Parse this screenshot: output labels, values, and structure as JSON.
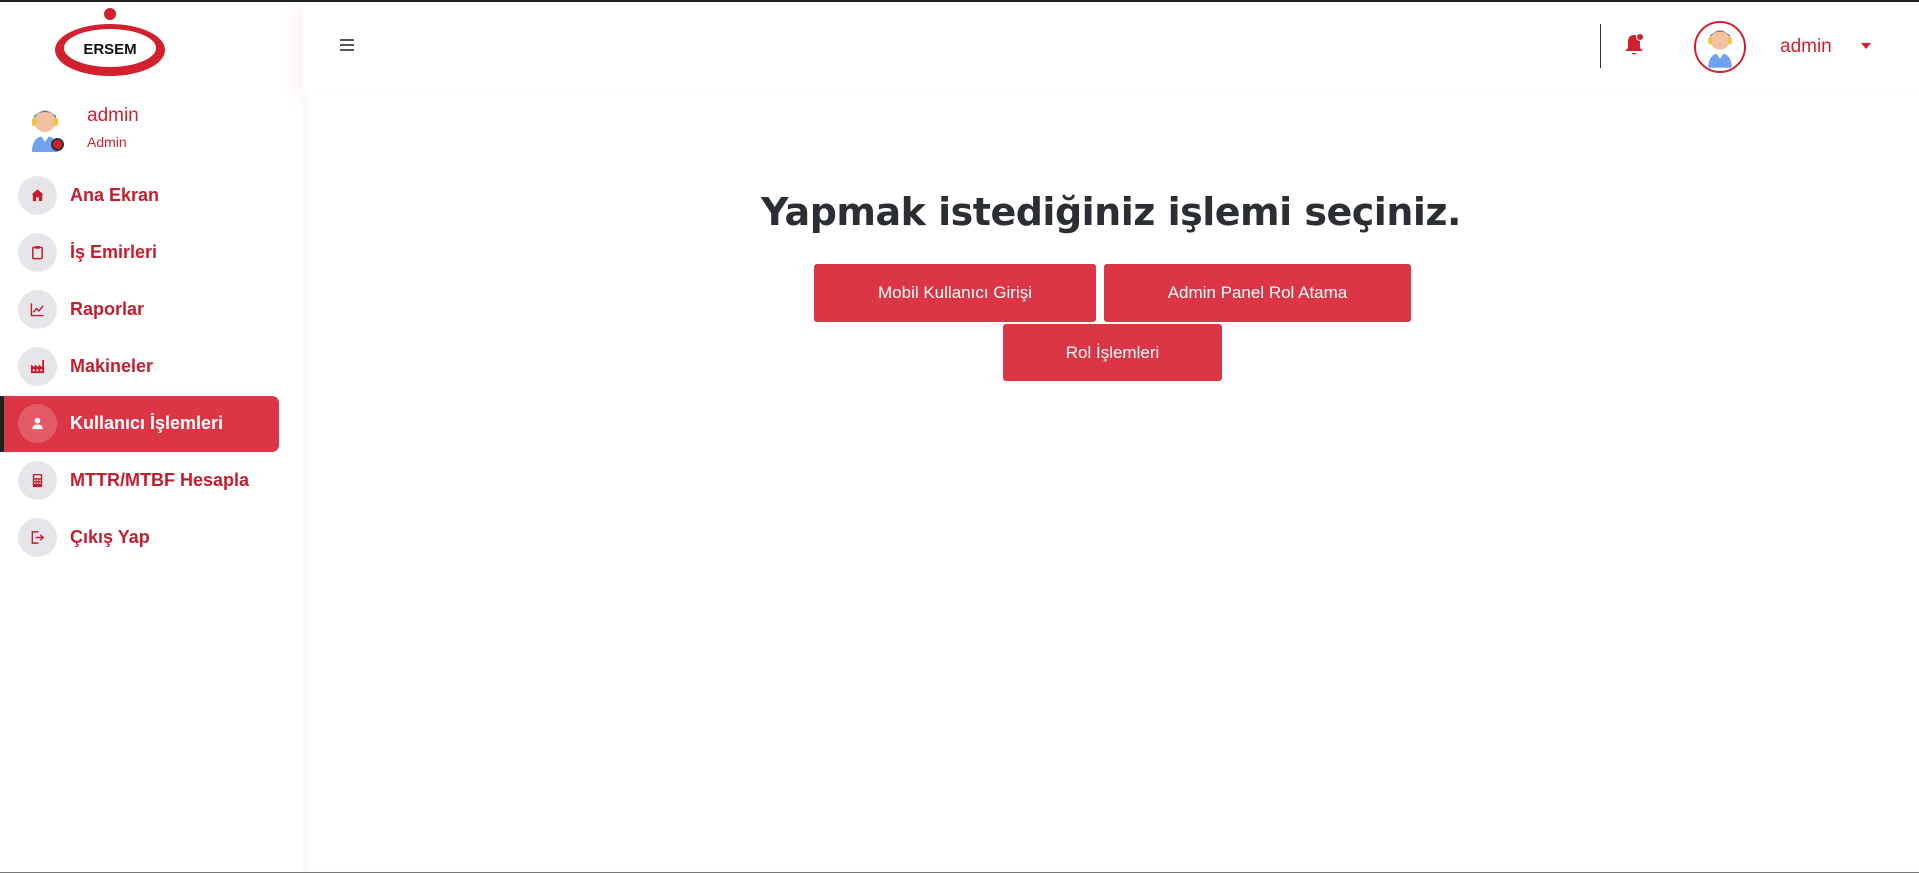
{
  "logo": {
    "text": "ERSEM"
  },
  "sidebar": {
    "user": {
      "name": "admin",
      "role": "Admin"
    },
    "items": [
      {
        "label": "Ana Ekran",
        "icon": "home-icon"
      },
      {
        "label": "İş Emirleri",
        "icon": "clipboard-icon"
      },
      {
        "label": "Raporlar",
        "icon": "chart-line-icon"
      },
      {
        "label": "Makineler",
        "icon": "factory-icon"
      },
      {
        "label": "Kullanıcı İşlemleri",
        "icon": "user-icon",
        "active": true
      },
      {
        "label": "MTTR/MTBF Hesapla",
        "icon": "calculator-icon"
      },
      {
        "label": "Çıkış Yap",
        "icon": "logout-icon"
      }
    ]
  },
  "header": {
    "username": "admin"
  },
  "main": {
    "title": "Yapmak istediğiniz işlemi seçiniz.",
    "buttons": {
      "mobile_login": "Mobil Kullanıcı Girişi",
      "admin_role": "Admin Panel Rol Atama",
      "role_ops": "Rol İşlemleri"
    }
  },
  "colors": {
    "accent": "#dc3545",
    "brand_red": "#d2202f"
  }
}
